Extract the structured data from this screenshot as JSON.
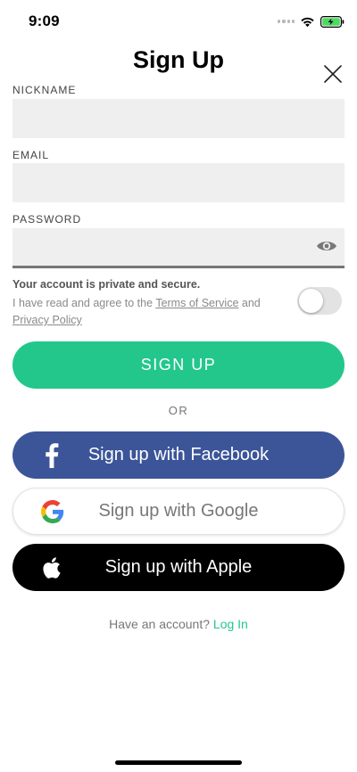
{
  "status_bar": {
    "time": "9:09",
    "battery_color": "#4cd964"
  },
  "header": {
    "title": "Sign Up",
    "close_icon": "close-icon"
  },
  "form": {
    "nickname_label": "NICKNAME",
    "nickname_value": "",
    "email_label": "EMAIL",
    "email_value": "",
    "password_label": "PASSWORD",
    "password_value": "",
    "password_toggle_icon": "eye-icon",
    "private_text": "Your account is private and secure.",
    "agree_prefix": "I have read and agree to the ",
    "terms_link": "Terms of Service",
    "agree_and": " and ",
    "privacy_link": "Privacy Policy",
    "agree_toggle_on": false
  },
  "actions": {
    "signup_label": "SIGN UP",
    "or_label": "OR",
    "facebook_label": "Sign up with Facebook",
    "google_label": "Sign up with Google",
    "apple_label": "Sign up with Apple"
  },
  "footer": {
    "have_account": "Have an account?",
    "login_label": "Log In"
  },
  "colors": {
    "accent": "#23c78b",
    "facebook": "#3c5599",
    "apple": "#000000",
    "field_bg": "#efefef"
  }
}
